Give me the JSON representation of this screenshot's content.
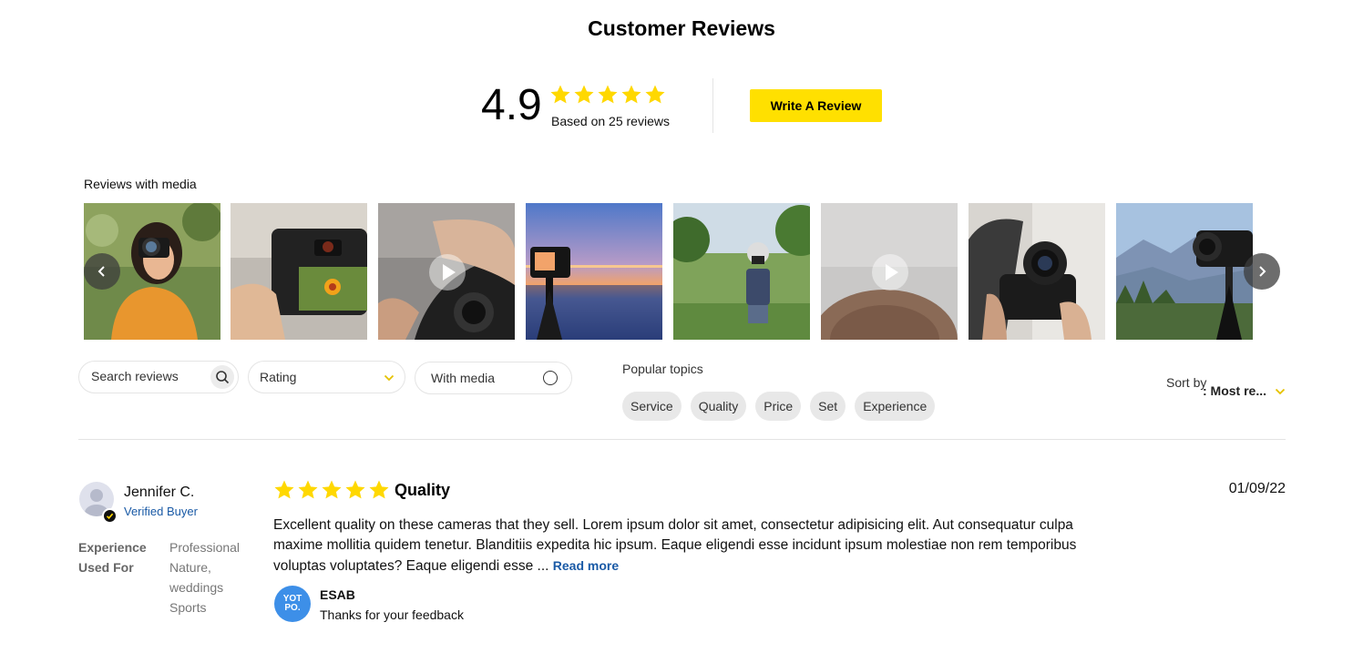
{
  "header": {
    "title": "Customer Reviews"
  },
  "summary": {
    "average_rating": "4.9",
    "stars": 5,
    "based_on": "Based on 25 reviews",
    "write_review_label": "Write A Review"
  },
  "media": {
    "label": "Reviews with media",
    "thumbnails": [
      {
        "subject": "woman with camera",
        "video": false
      },
      {
        "subject": "camera flower viewfinder",
        "video": false
      },
      {
        "subject": "hands holding camera",
        "video": true
      },
      {
        "subject": "sunset beach camera",
        "video": false
      },
      {
        "subject": "child photographer",
        "video": false
      },
      {
        "subject": "blurred hair",
        "video": true
      },
      {
        "subject": "camera held in hands",
        "video": false
      },
      {
        "subject": "camera on tripod mountains",
        "video": false
      }
    ]
  },
  "filters": {
    "search_placeholder": "Search reviews",
    "rating_label": "Rating",
    "with_media_label": "With media",
    "popular_topics_label": "Popular topics",
    "topics": [
      "Service",
      "Quality",
      "Price",
      "Set",
      "Experience"
    ],
    "sort_by_label": "Sort by",
    "sort_value": ": Most re..."
  },
  "review": {
    "reviewer": "Jennifer C.",
    "verified": "Verified Buyer",
    "attribute_label": "Experience Used For",
    "attribute_values": [
      "Professional",
      "Nature,",
      "weddings",
      "Sports"
    ],
    "rating": 5,
    "title": "Quality",
    "date": "01/09/22",
    "body": "Excellent quality on these cameras that they sell. Lorem ipsum dolor sit amet, consectetur adipisicing elit. Aut consequatur culpa maxime mollitia quidem tenetur. Blanditiis expedita hic ipsum. Eaque eligendi esse incidunt ipsum molestiae non rem temporibus voluptas voluptates? Eaque eligendi esse ...",
    "read_more": "Read more",
    "reply": {
      "logo_text": "YOT PO.",
      "name": "ESAB",
      "text": "Thanks for your feedback"
    }
  },
  "colors": {
    "accent": "#ffe000",
    "link": "#1a5aa6",
    "star": "#ffd800"
  }
}
